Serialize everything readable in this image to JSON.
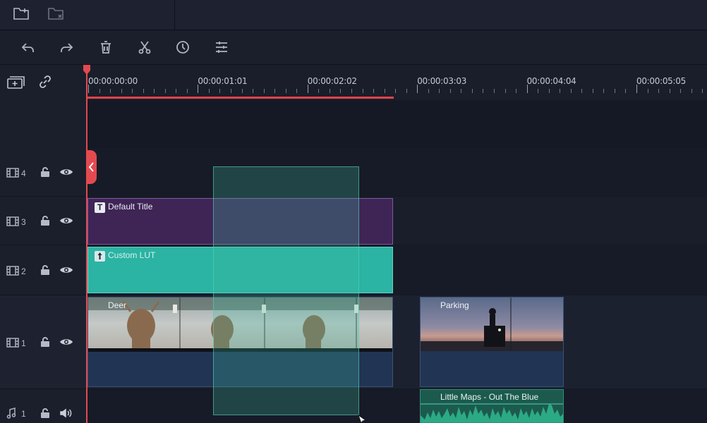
{
  "topbar": {
    "buttons": [
      {
        "name": "add-folder-icon"
      },
      {
        "name": "delete-folder-icon"
      }
    ]
  },
  "toolbar": {
    "buttons": [
      {
        "name": "undo-icon"
      },
      {
        "name": "redo-icon"
      },
      {
        "name": "delete-icon"
      },
      {
        "name": "cut-icon"
      },
      {
        "name": "duration-icon"
      },
      {
        "name": "adjust-icon"
      }
    ]
  },
  "ruler": {
    "timecodes": [
      "00:00:00:00",
      "00:00:01:01",
      "00:00:02:02",
      "00:00:03:03",
      "00:00:04:04",
      "00:00:05:05"
    ]
  },
  "tracks": [
    {
      "type": "video",
      "number": "4"
    },
    {
      "type": "video",
      "number": "3"
    },
    {
      "type": "video",
      "number": "2"
    },
    {
      "type": "video",
      "number": "1"
    },
    {
      "type": "audio",
      "number": "1"
    }
  ],
  "clips": {
    "title": {
      "label": "Default Title",
      "badge": "T",
      "color": "#3f2456"
    },
    "lut": {
      "label": "Custom LUT",
      "color": "#2bb3a3"
    },
    "deer": {
      "label": "Deer"
    },
    "parking": {
      "label": "Parking"
    },
    "music": {
      "label": "Little Maps - Out The Blue"
    }
  },
  "colors": {
    "playhead": "#e34a50",
    "selection": "#3fbfa4",
    "audio_wave": "#2fb98f"
  }
}
